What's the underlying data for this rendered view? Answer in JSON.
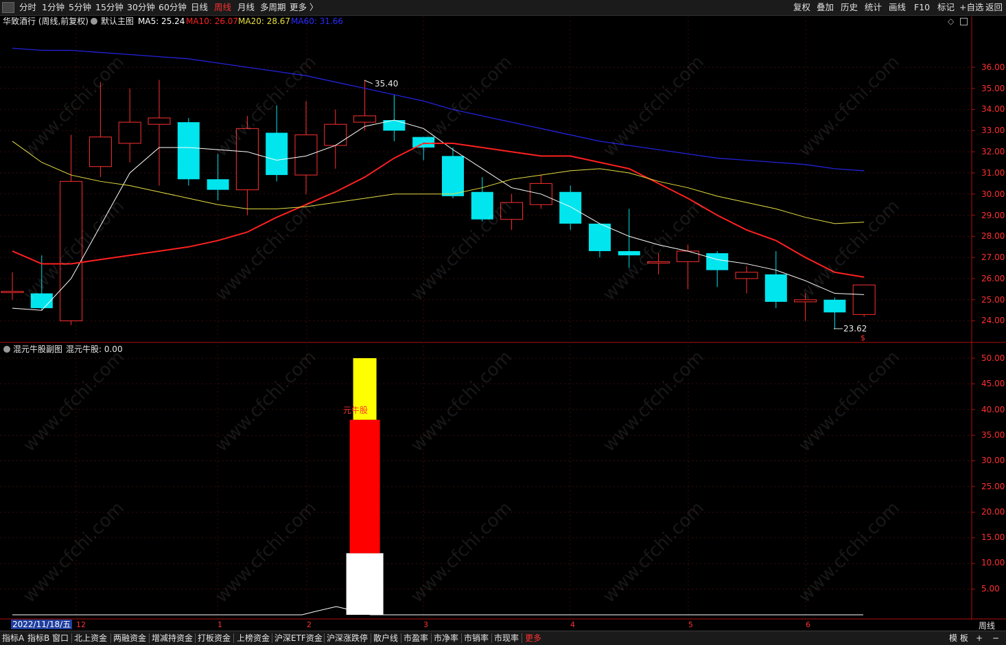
{
  "toolbar": {
    "periods": [
      "分时",
      "1分钟",
      "5分钟",
      "15分钟",
      "30分钟",
      "60分钟",
      "日线",
      "周线",
      "月线",
      "多周期",
      "更多 〉"
    ],
    "active_period": "周线",
    "right_buttons": [
      "复权",
      "叠加",
      "历史",
      "统计",
      "画线",
      "F10",
      "标记",
      "+自选",
      "返回"
    ]
  },
  "main_chart": {
    "title": "华致酒行 (周线,前复权)",
    "template": "默认主图",
    "ma5": "MA5: 25.24",
    "ma10": "MA10: 26.07",
    "ma20": "MA20: 28.67",
    "ma60": "MA60: 31.66",
    "high_label": "35.40",
    "low_label": "23.62",
    "y_ticks": [
      "36.00",
      "35.00",
      "34.00",
      "33.00",
      "32.00",
      "31.00",
      "30.00",
      "29.00",
      "28.00",
      "27.00",
      "26.00",
      "25.00",
      "24.00"
    ],
    "colors": {
      "ma5": "#ffffff",
      "ma10": "#ff2020",
      "ma20": "#e8e040",
      "ma60": "#2222dd",
      "up": "#ff3030",
      "down": "#00e5ee"
    }
  },
  "sub_chart": {
    "title": "混元牛股副图",
    "value": "混元牛股: 0.00",
    "annotation": "元牛股",
    "y_ticks": [
      "50.00",
      "45.00",
      "40.00",
      "35.00",
      "30.00",
      "25.00",
      "20.00",
      "15.00",
      "10.00",
      "5.00"
    ]
  },
  "time_axis": {
    "current_date": "2022/11/18/五",
    "month_labels": [
      "12",
      "1",
      "2",
      "3",
      "4",
      "5",
      "6"
    ],
    "period": "周线"
  },
  "bottom_tabs": [
    "指标A",
    "指标B",
    "窗口",
    "北上资金",
    "两融资金",
    "增减持资金",
    "打板资金",
    "上榜资金",
    "沪深ETF资金",
    "沪深涨跌停",
    "散户线",
    "市盈率",
    "市净率",
    "市销率",
    "市现率",
    "更多"
  ],
  "bottom_right": [
    "模 板",
    "+",
    "−"
  ],
  "watermark": "www.cfchi.com",
  "chart_data": {
    "type": "candlestick",
    "series": [
      {
        "name": "K",
        "ohlc": [
          [
            25.4,
            25.4,
            26.3,
            25.0
          ],
          [
            25.3,
            24.6,
            27.1,
            24.5
          ],
          [
            24.0,
            30.6,
            32.8,
            23.8
          ],
          [
            31.3,
            32.7,
            35.3,
            30.8
          ],
          [
            32.4,
            33.4,
            35.0,
            31.5
          ],
          [
            33.3,
            33.6,
            35.4,
            30.4
          ],
          [
            33.4,
            30.7,
            33.6,
            30.4
          ],
          [
            30.7,
            30.2,
            31.9,
            29.7
          ],
          [
            30.2,
            33.1,
            33.7,
            29.0
          ],
          [
            32.9,
            30.9,
            34.2,
            30.6
          ],
          [
            30.9,
            32.8,
            34.4,
            30.0
          ],
          [
            32.3,
            33.3,
            34.0,
            31.2
          ],
          [
            33.4,
            33.7,
            35.4,
            33.0
          ],
          [
            33.5,
            33.0,
            34.7,
            32.5
          ],
          [
            32.7,
            32.2,
            32.7,
            31.6
          ],
          [
            31.8,
            29.9,
            32.2,
            29.8
          ],
          [
            30.1,
            28.8,
            30.8,
            28.7
          ],
          [
            28.8,
            29.6,
            30.0,
            28.3
          ],
          [
            29.5,
            30.5,
            30.9,
            29.3
          ],
          [
            30.1,
            28.6,
            30.4,
            28.3
          ],
          [
            28.6,
            27.3,
            28.6,
            27.0
          ],
          [
            27.3,
            27.1,
            29.3,
            26.5
          ],
          [
            26.8,
            26.8,
            27.2,
            26.2
          ],
          [
            26.8,
            27.3,
            27.6,
            25.5
          ],
          [
            27.2,
            26.4,
            27.3,
            25.6
          ],
          [
            26.0,
            26.3,
            26.6,
            25.3
          ],
          [
            26.2,
            24.9,
            27.3,
            24.6
          ],
          [
            24.9,
            25.0,
            25.3,
            24.0
          ],
          [
            25.0,
            24.4,
            25.1,
            23.6
          ],
          [
            24.3,
            25.7,
            25.7,
            24.2
          ]
        ]
      },
      {
        "name": "MA5",
        "values": [
          24.6,
          24.5,
          26.0,
          28.5,
          31.0,
          32.2,
          32.2,
          32.1,
          32.0,
          31.6,
          31.8,
          32.3,
          33.2,
          33.5,
          33.1,
          32.1,
          31.2,
          30.3,
          30.0,
          29.4,
          28.6,
          28.0,
          27.6,
          27.3,
          26.9,
          26.7,
          26.4,
          25.9,
          25.3,
          25.24
        ]
      },
      {
        "name": "MA10",
        "values": [
          27.3,
          26.7,
          26.7,
          26.9,
          27.1,
          27.3,
          27.5,
          27.8,
          28.2,
          28.9,
          29.5,
          30.1,
          30.8,
          31.7,
          32.4,
          32.4,
          32.2,
          32.0,
          31.8,
          31.8,
          31.5,
          31.2,
          30.5,
          29.8,
          29.0,
          28.3,
          27.8,
          27.0,
          26.3,
          26.07
        ]
      },
      {
        "name": "MA20",
        "values": [
          32.5,
          31.5,
          30.9,
          30.6,
          30.4,
          30.1,
          29.8,
          29.5,
          29.3,
          29.3,
          29.4,
          29.6,
          29.8,
          30.0,
          30.0,
          30.0,
          30.3,
          30.7,
          30.9,
          31.1,
          31.2,
          31.0,
          30.6,
          30.3,
          29.9,
          29.6,
          29.3,
          28.9,
          28.6,
          28.67
        ]
      },
      {
        "name": "MA60",
        "values": [
          36.9,
          36.8,
          36.8,
          36.7,
          36.6,
          36.5,
          36.4,
          36.2,
          36.0,
          35.8,
          35.6,
          35.3,
          35.0,
          34.7,
          34.4,
          34.0,
          33.7,
          33.4,
          33.1,
          32.8,
          32.5,
          32.3,
          32.1,
          31.9,
          31.7,
          31.6,
          31.5,
          31.4,
          31.2,
          31.1
        ]
      }
    ],
    "sub_indicator": {
      "name": "混元牛股",
      "bar_index": 12,
      "white_top": 12.0,
      "red_top": 38.0,
      "yellow_top": 50.0
    },
    "ylim_main": [
      23.5,
      37.0
    ],
    "ylim_sub": [
      0,
      52
    ]
  }
}
